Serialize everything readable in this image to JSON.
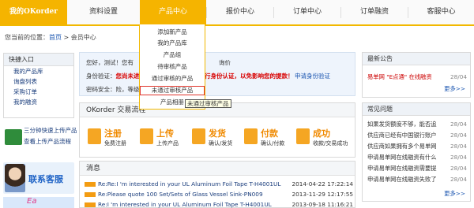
{
  "nav": {
    "home": "我的OKorder",
    "items": [
      "资料设置",
      "产品中心",
      "报价中心",
      "订单中心",
      "订单融资",
      "客服中心"
    ]
  },
  "breadcrumb": {
    "prefix": "您当前的位置：",
    "home": "首页",
    "sep": " > ",
    "current": "会员中心"
  },
  "left": {
    "quick_title": "快捷入口",
    "quick_items": [
      "我的产品库",
      "询盘列表",
      "采购订单",
      "我的融资"
    ],
    "promo_line1": "三分钟快速上传产品",
    "promo_line2": "查看上传产品流程",
    "service": "联系客服"
  },
  "profile": {
    "hello": "您好，测试！您有",
    "hello_tail": "询价",
    "status_label": "身份验证：",
    "warning": "您尚未进行身份认证，点击这里进行身份认证，以免影响您的提款！",
    "apply_link": "申请身份验证",
    "security_label": "密码安全：",
    "security_tail": "险，等级偏低"
  },
  "okbox": {
    "title": "OKorder 交易流程",
    "steps": [
      {
        "title": "注册",
        "sub": "免费注册",
        "color": "#f08a00"
      },
      {
        "title": "上传",
        "sub": "上传产品",
        "color": "#f08a00"
      },
      {
        "title": "发货",
        "sub": "确认/发货",
        "color": "#f08a00"
      },
      {
        "title": "付款",
        "sub": "确认/付款",
        "color": "#f08a00"
      },
      {
        "title": "成功",
        "sub": "收款/交易成功",
        "color": "#f08a00"
      }
    ]
  },
  "messages": {
    "title": "消息",
    "rows": [
      {
        "subject": "Re:Re:I 'm interested in your UL Aluminum Foil Tape T-H4001UL",
        "date": "2014-04-22 17:22:14"
      },
      {
        "subject": "Re:Please quote 100 Set/Sets of Glass Vessel Sink-PN009",
        "date": "2013-11-29 12:17:55"
      },
      {
        "subject": "Re:I 'm interested in your UL Aluminum Foil Tape T-H4001UL",
        "date": "2013-09-18 11:16:21"
      }
    ]
  },
  "notice": {
    "title": "最新公告",
    "rows": [
      {
        "text": "易单网 \"E点通\" 在线融资",
        "date": "28/04"
      }
    ],
    "more": "更多>>"
  },
  "faq": {
    "title": "常见问题",
    "rows": [
      {
        "text": "如果发货额度不够，能否追",
        "date": "28/04"
      },
      {
        "text": "供应商已经有中国银行账户",
        "date": "28/04"
      },
      {
        "text": "供应商如果拥有多个易单网",
        "date": "28/04"
      },
      {
        "text": "申请易单网在线融资有什么",
        "date": "28/04"
      },
      {
        "text": "申请易单网在线融资需要提",
        "date": "28/04"
      },
      {
        "text": "申请易单网在线融资失败了",
        "date": "28/04"
      }
    ],
    "more": "更多>>"
  },
  "dropdown": {
    "items": [
      "添加新产品",
      "我的产品库",
      "产品组",
      "待审核产品",
      "通过审核的产品",
      "未通过审核产品",
      "产品相册"
    ],
    "hover_index": 5
  },
  "tooltip": "未通过审核产品"
}
